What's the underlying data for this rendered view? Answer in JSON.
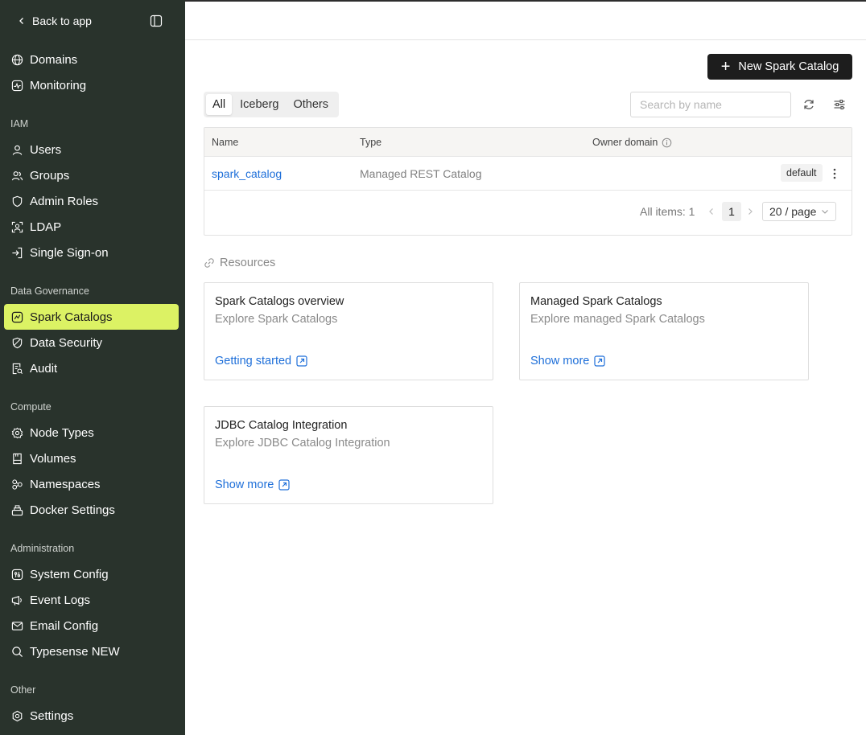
{
  "sidebar": {
    "back_label": "Back to app",
    "top_items": [
      {
        "label": "Domains",
        "icon": "globe-icon"
      },
      {
        "label": "Monitoring",
        "icon": "monitor-icon"
      }
    ],
    "sections": [
      {
        "title": "IAM",
        "items": [
          {
            "label": "Users",
            "icon": "user-icon"
          },
          {
            "label": "Groups",
            "icon": "users-icon"
          },
          {
            "label": "Admin Roles",
            "icon": "shield-icon"
          },
          {
            "label": "LDAP",
            "icon": "ldap-icon"
          },
          {
            "label": "Single Sign-on",
            "icon": "login-icon"
          }
        ]
      },
      {
        "title": "Data Governance",
        "items": [
          {
            "label": "Spark Catalogs",
            "icon": "catalog-icon",
            "active": true
          },
          {
            "label": "Data Security",
            "icon": "security-icon"
          },
          {
            "label": "Audit",
            "icon": "audit-icon"
          }
        ]
      },
      {
        "title": "Compute",
        "items": [
          {
            "label": "Node Types",
            "icon": "cpu-icon"
          },
          {
            "label": "Volumes",
            "icon": "volume-icon"
          },
          {
            "label": "Namespaces",
            "icon": "namespace-icon"
          },
          {
            "label": "Docker Settings",
            "icon": "docker-icon"
          }
        ]
      },
      {
        "title": "Administration",
        "items": [
          {
            "label": "System Config",
            "icon": "config-icon"
          },
          {
            "label": "Event Logs",
            "icon": "event-icon"
          },
          {
            "label": "Email Config",
            "icon": "mail-icon"
          },
          {
            "label": "Typesense NEW",
            "icon": "search-icon"
          }
        ]
      },
      {
        "title": "Other",
        "items": [
          {
            "label": "Settings",
            "icon": "gear-icon"
          }
        ]
      }
    ],
    "active_color": "#dcf264",
    "background": "#29332c"
  },
  "toolbar": {
    "new_button_label": "New Spark Catalog",
    "tabs": [
      "All",
      "Iceberg",
      "Others"
    ],
    "selected_tab": "All",
    "search_placeholder": "Search by name"
  },
  "table": {
    "columns": [
      "Name",
      "Type",
      "Owner domain"
    ],
    "rows": [
      {
        "name": "spark_catalog",
        "type": "Managed REST Catalog",
        "owner_domain": "default"
      }
    ],
    "pagination": {
      "total_label": "All items: 1",
      "current_page": "1",
      "page_size": "20 / page"
    }
  },
  "resources": {
    "title": "Resources",
    "cards": [
      {
        "title": "Spark Catalogs overview",
        "subtitle": "Explore Spark Catalogs",
        "link": "Getting started"
      },
      {
        "title": "Managed Spark Catalogs",
        "subtitle": "Explore managed Spark Catalogs",
        "link": "Show more"
      },
      {
        "title": "JDBC Catalog Integration",
        "subtitle": "Explore JDBC Catalog Integration",
        "link": "Show more"
      }
    ]
  }
}
